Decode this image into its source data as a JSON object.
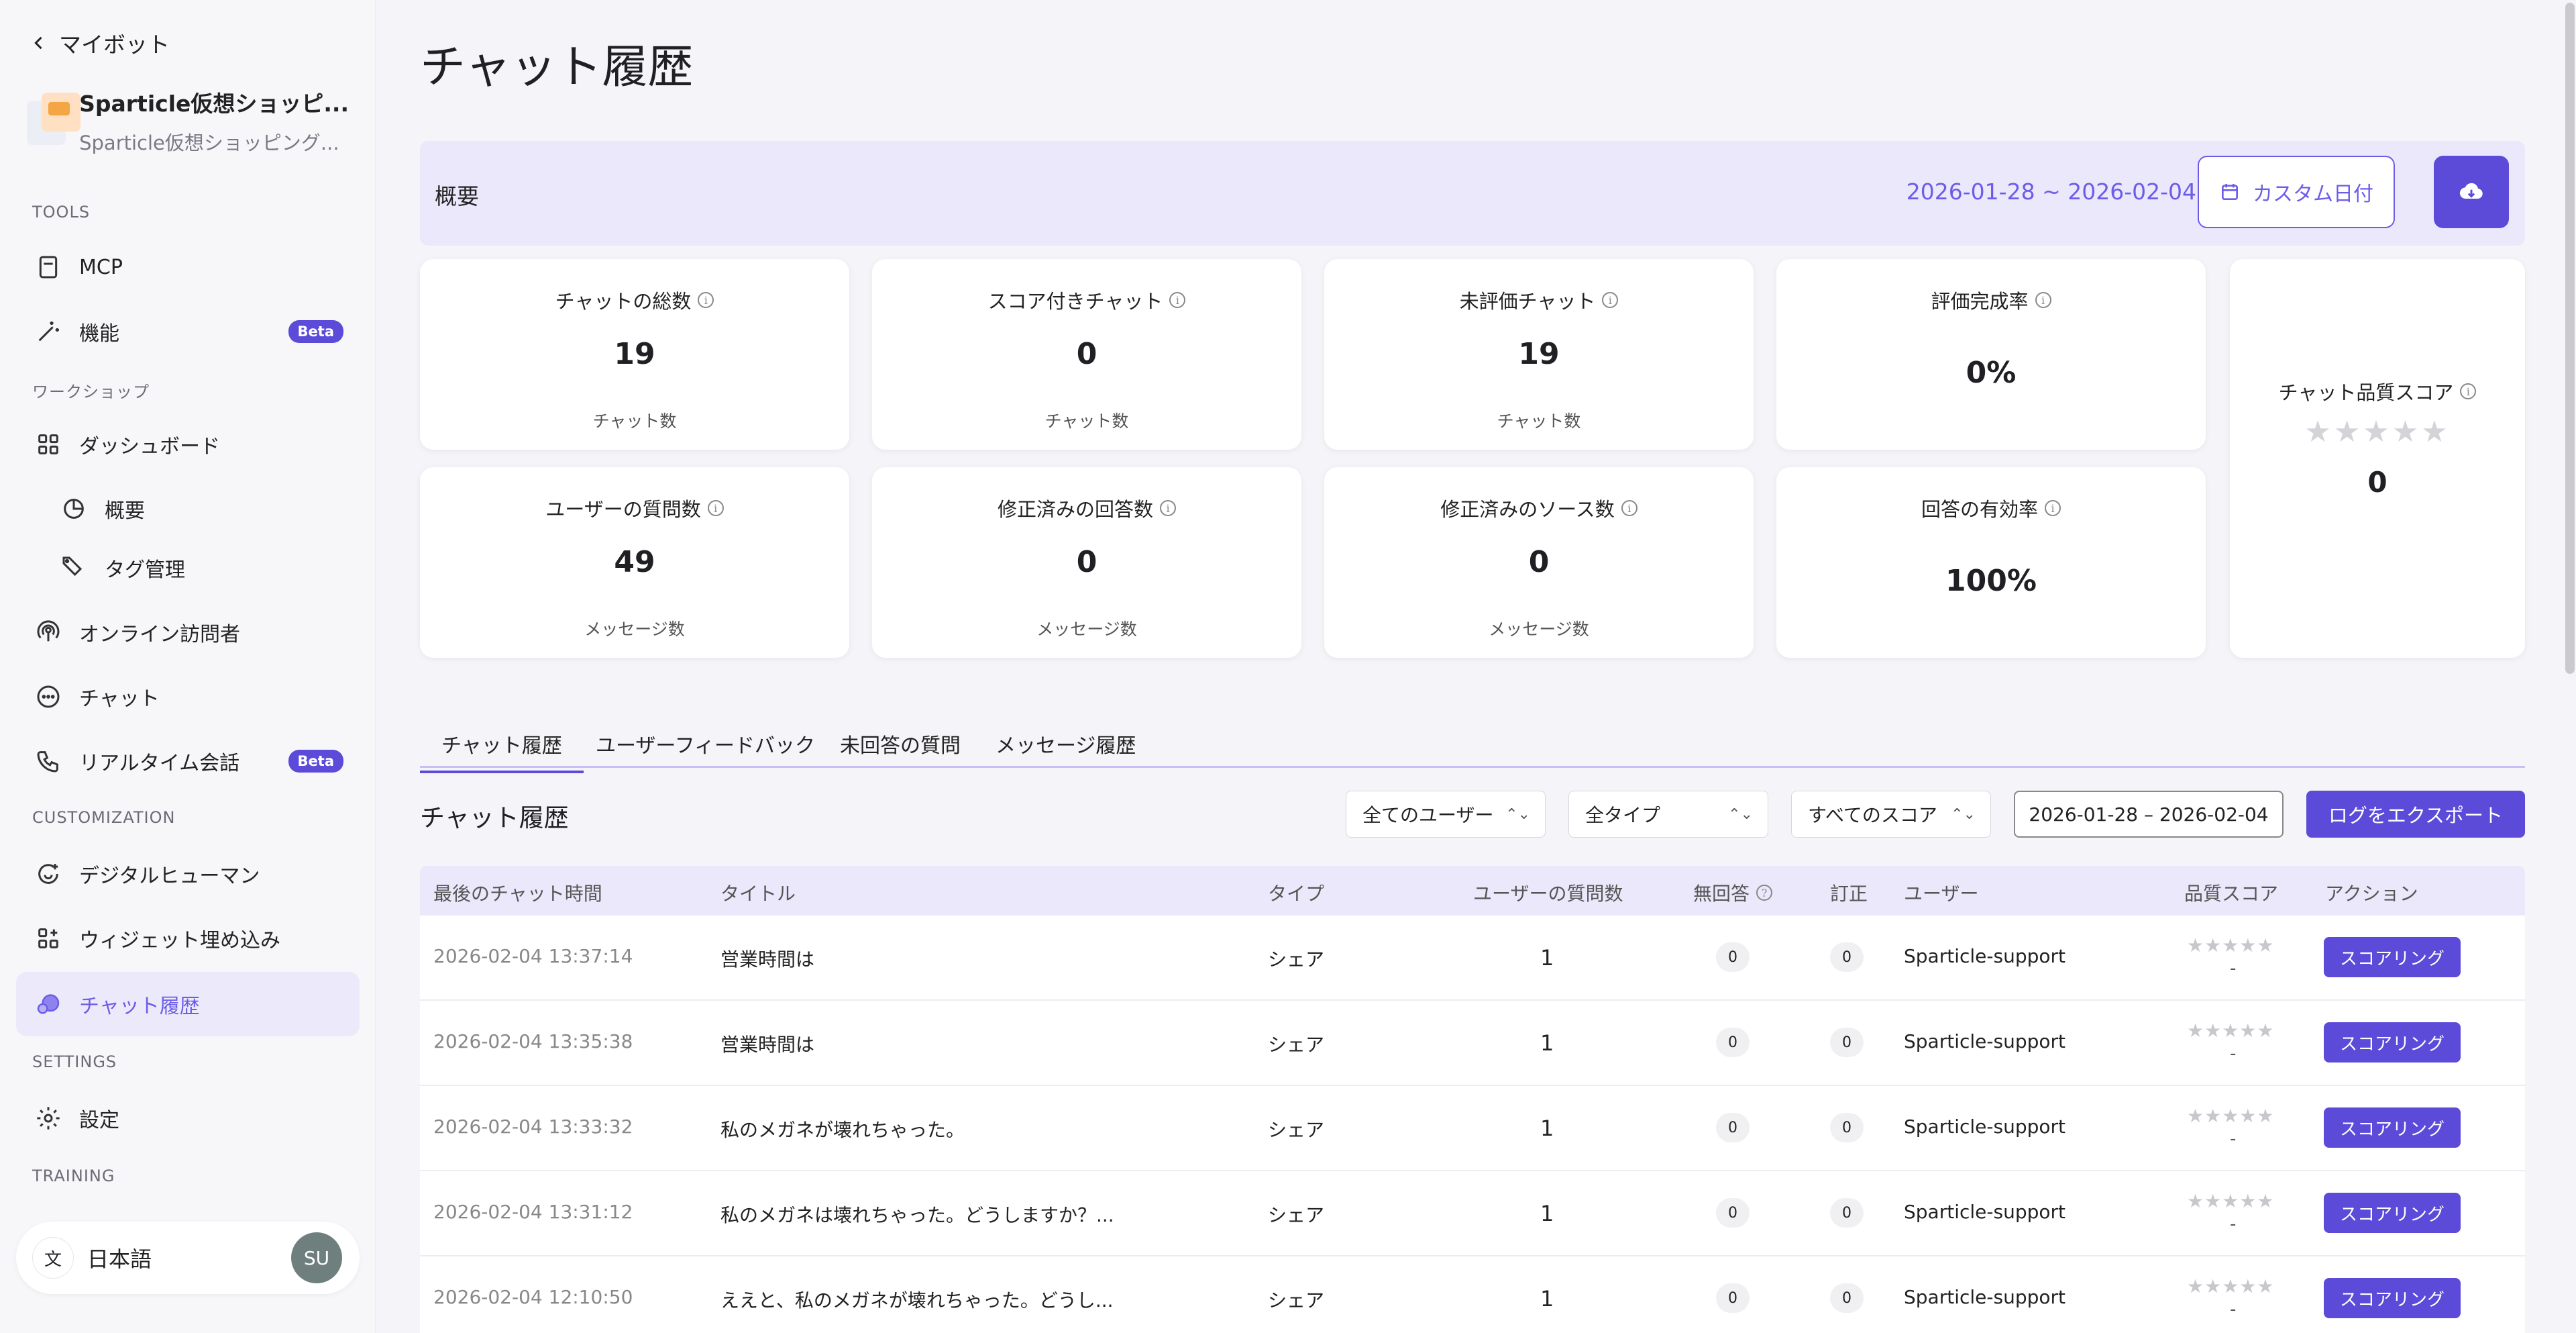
{
  "sidebar": {
    "back_label": "マイボット",
    "bot_name": "Sparticle仮想ショッピ...",
    "bot_sub": "Sparticle仮想ショッピング...",
    "sections": {
      "tools": "TOOLS",
      "workshop": "ワークショップ",
      "customization": "CUSTOMIZATION",
      "settings": "SETTINGS",
      "training": "TRAINING"
    },
    "items": {
      "mcp": "MCP",
      "features": "機能",
      "dashboard": "ダッシュボード",
      "overview": "概要",
      "tags": "タグ管理",
      "online_visitors": "オンライン訪問者",
      "chat": "チャット",
      "realtime": "リアルタイム会話",
      "digital_human": "デジタルヒューマン",
      "widget": "ウィジェット埋め込み",
      "chat_history": "チャット履歴",
      "settings": "設定"
    },
    "beta": "Beta",
    "language": "日本語",
    "user_initials": "SU"
  },
  "page": {
    "title": "チャット履歴"
  },
  "overview": {
    "label": "概要",
    "range": "2026-01-28 ~ 2026-02-04",
    "custom_date": "カスタム日付"
  },
  "stats": {
    "total_chats": {
      "title": "チャットの総数",
      "value": "19",
      "unit": "チャット数"
    },
    "scored_chats": {
      "title": "スコア付きチャット",
      "value": "0",
      "unit": "チャット数"
    },
    "unrated_chats": {
      "title": "未評価チャット",
      "value": "19",
      "unit": "チャット数"
    },
    "rating_rate": {
      "title": "評価完成率",
      "value": "0%"
    },
    "user_questions": {
      "title": "ユーザーの質問数",
      "value": "49",
      "unit": "メッセージ数"
    },
    "fixed_answers": {
      "title": "修正済みの回答数",
      "value": "0",
      "unit": "メッセージ数"
    },
    "fixed_sources": {
      "title": "修正済みのソース数",
      "value": "0",
      "unit": "メッセージ数"
    },
    "answer_rate": {
      "title": "回答の有効率",
      "value": "100%"
    },
    "quality": {
      "title": "チャット品質スコア",
      "value": "0",
      "stars": "★★★★★"
    }
  },
  "tabs": [
    "チャット履歴",
    "ユーザーフィードバック",
    "未回答の質問",
    "メッセージ履歴"
  ],
  "list": {
    "title": "チャット履歴",
    "filter_users": "全てのユーザー",
    "filter_types": "全タイプ",
    "filter_scores": "すべてのスコア",
    "date_range": "2026-01-28 – 2026-02-04",
    "export": "ログをエクスポート"
  },
  "table": {
    "headers": {
      "time": "最後のチャット時間",
      "title": "タイトル",
      "type": "タイプ",
      "questions": "ユーザーの質問数",
      "unanswered": "無回答",
      "corrections": "訂正",
      "user": "ユーザー",
      "score": "品質スコア",
      "action": "アクション"
    },
    "rows": [
      {
        "time": "2026-02-04 13:37:14",
        "title": "営業時間は",
        "type": "シェア",
        "questions": "1",
        "unanswered": "0",
        "corrections": "0",
        "user": "Sparticle-support",
        "stars": "★★★★★",
        "score": "-",
        "action": "スコアリング"
      },
      {
        "time": "2026-02-04 13:35:38",
        "title": "営業時間は",
        "type": "シェア",
        "questions": "1",
        "unanswered": "0",
        "corrections": "0",
        "user": "Sparticle-support",
        "stars": "★★★★★",
        "score": "-",
        "action": "スコアリング"
      },
      {
        "time": "2026-02-04 13:33:32",
        "title": "私のメガネが壊れちゃった。",
        "type": "シェア",
        "questions": "1",
        "unanswered": "0",
        "corrections": "0",
        "user": "Sparticle-support",
        "stars": "★★★★★",
        "score": "-",
        "action": "スコアリング"
      },
      {
        "time": "2026-02-04 13:31:12",
        "title": "私のメガネは壊れちゃった。どうしますか？...",
        "type": "シェア",
        "questions": "1",
        "unanswered": "0",
        "corrections": "0",
        "user": "Sparticle-support",
        "stars": "★★★★★",
        "score": "-",
        "action": "スコアリング"
      },
      {
        "time": "2026-02-04 12:10:50",
        "title": "ええと、私のメガネが壊れちゃった。どうし...",
        "type": "シェア",
        "questions": "1",
        "unanswered": "0",
        "corrections": "0",
        "user": "Sparticle-support",
        "stars": "★★★★★",
        "score": "-",
        "action": "スコアリング"
      }
    ]
  },
  "colors": {
    "accent": "#5b4bd8",
    "accent_light": "#ebe8fc"
  }
}
